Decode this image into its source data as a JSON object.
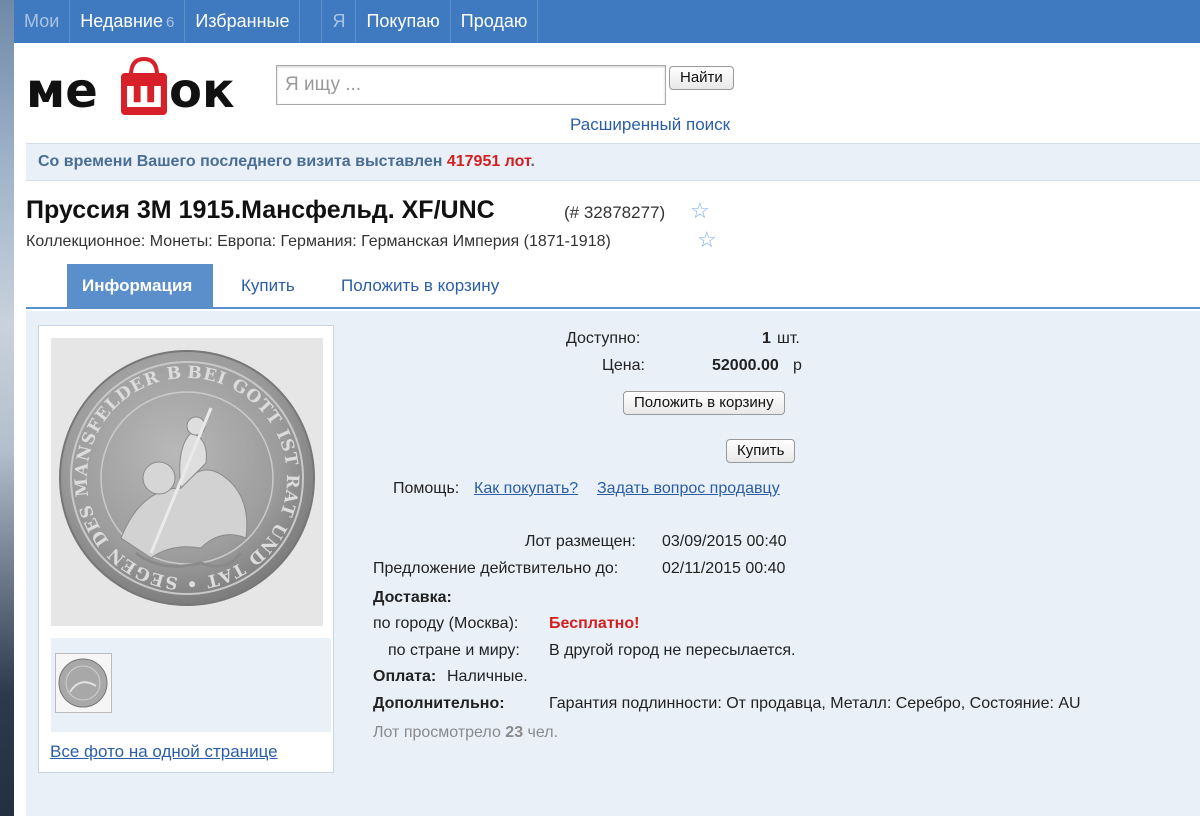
{
  "topnav": {
    "items": [
      {
        "label": "Мои"
      },
      {
        "label": "Недавние",
        "count": "6"
      },
      {
        "label": "Избранные"
      },
      {
        "label": "Я"
      },
      {
        "label": "Покупаю"
      },
      {
        "label": "Продаю"
      }
    ]
  },
  "header": {
    "logo_text": "мешок",
    "search_placeholder": "Я ищу ...",
    "find_button": "Найти",
    "advanced_search": "Расширенный поиск"
  },
  "notice": {
    "text_before": "Со времени Вашего последнего визита выставлен",
    "count": "417951 лот",
    "text_after": "."
  },
  "lot": {
    "title": "Пруссия 3М 1915.Мансфельд. XF/UNC",
    "number": "(# 32878277)",
    "breadcrumb": "Коллекционное: Монеты: Европа: Германия: Германская Империя (1871-1918)"
  },
  "tabs": [
    {
      "label": "Информация",
      "active": true
    },
    {
      "label": "Купить"
    },
    {
      "label": "Положить в корзину"
    }
  ],
  "photos": {
    "all_photos_link": "Все фото на одной странице",
    "coin_inscription": "BEI GOTT IST RAT UND TAT • SEGEN DES MANSFELDER BERGBAUES"
  },
  "details": {
    "available_label": "Доступно:",
    "available_value": "1",
    "available_unit": "шт.",
    "price_label": "Цена:",
    "price_value": "52000.00",
    "price_unit": "р",
    "add_to_cart_button": "Положить в корзину",
    "buy_button": "Купить",
    "help_label": "Помощь:",
    "help_link_1": "Как покупать?",
    "help_link_2": "Задать вопрос продавцу",
    "posted_label": "Лот размещен:",
    "posted_value": "03/09/2015 00:40",
    "valid_label": "Предложение действительно до:",
    "valid_value": "02/11/2015 00:40",
    "delivery_label": "Доставка:",
    "city_label": "по городу (Москва):",
    "city_value": "Бесплатно!",
    "world_label": "по стране и миру:",
    "world_value": "В другой город не пересылается.",
    "payment_label": "Оплата:",
    "payment_value": "Наличные.",
    "extra_label": "Дополнительно:",
    "extra_value": "Гарантия подлинности: От продавца, Металл: Серебро, Состояние: AU",
    "views_before": "Лот просмотрело",
    "views_count": "23",
    "views_after": "чел."
  },
  "colors": {
    "nav_bg": "#3f79bf",
    "accent": "#5b8fcc",
    "link": "#2b5ea7",
    "alert_red": "#d21f1f",
    "panel_bg": "#e9f0f8"
  }
}
